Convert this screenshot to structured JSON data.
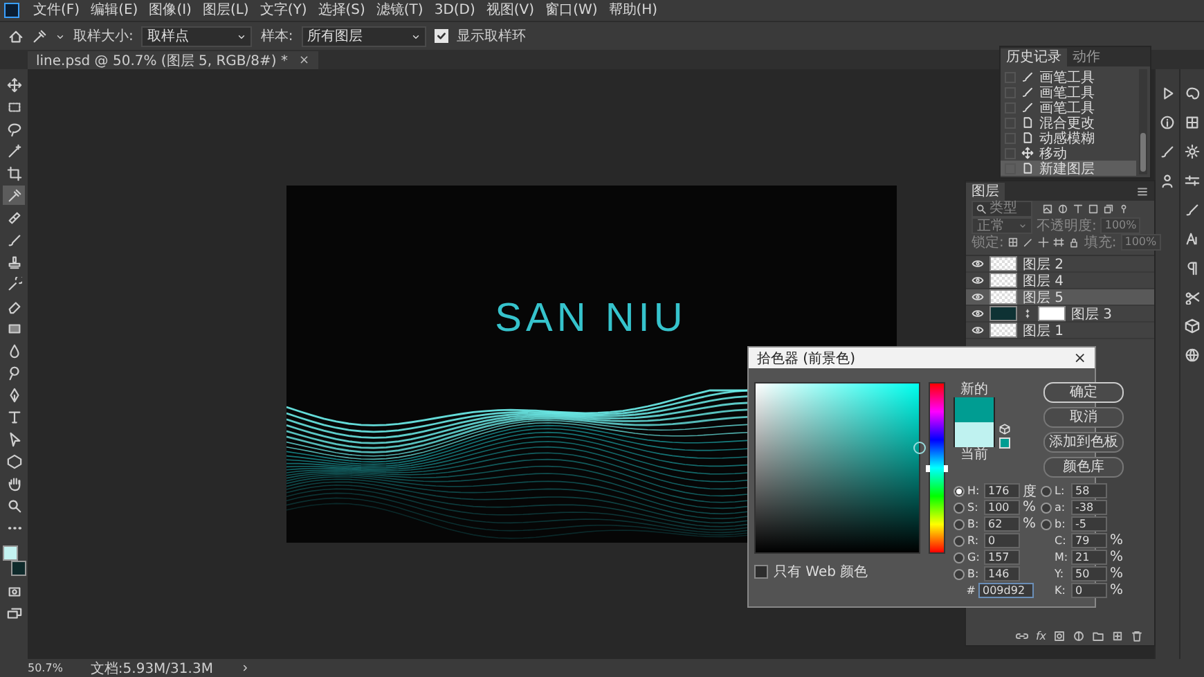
{
  "menu": [
    "文件(F)",
    "编辑(E)",
    "图像(I)",
    "图层(L)",
    "文字(Y)",
    "选择(S)",
    "滤镜(T)",
    "3D(D)",
    "视图(V)",
    "窗口(W)",
    "帮助(H)"
  ],
  "options_bar": {
    "sample_size_label": "取样大小:",
    "sample_size": "取样点",
    "sample_label": "样本:",
    "sample": "所有图层",
    "show_ring": {
      "label": "显示取样环",
      "checked": true
    }
  },
  "document_tab": {
    "title": "line.psd @ 50.7% (图层 5, RGB/8#) *",
    "close": "×"
  },
  "toolbar": {
    "tools": [
      {
        "kind": "move",
        "selected": false
      },
      {
        "kind": "marquee",
        "selected": false
      },
      {
        "kind": "lasso",
        "selected": false
      },
      {
        "kind": "wand",
        "selected": false
      },
      {
        "kind": "crop",
        "selected": false
      },
      {
        "kind": "eyedropper",
        "selected": true
      },
      {
        "kind": "heal",
        "selected": false
      },
      {
        "kind": "brush",
        "selected": false
      },
      {
        "kind": "stamp",
        "selected": false
      },
      {
        "kind": "history",
        "selected": false
      },
      {
        "kind": "eraser",
        "selected": false
      },
      {
        "kind": "gradient",
        "selected": false
      },
      {
        "kind": "drop",
        "selected": false
      },
      {
        "kind": "dodge",
        "selected": false
      },
      {
        "kind": "pen",
        "selected": false
      },
      {
        "kind": "type",
        "selected": false
      },
      {
        "kind": "select",
        "selected": false
      },
      {
        "kind": "shape",
        "selected": false
      },
      {
        "kind": "hand",
        "selected": false
      },
      {
        "kind": "zoom",
        "selected": false
      },
      {
        "kind": "more",
        "selected": false
      }
    ],
    "color_swatches": [
      {
        "color": "#c4f3f1"
      },
      {
        "color": "#0f2a2b"
      }
    ],
    "mode_tools": [
      {
        "kind": "quickmask"
      },
      {
        "kind": "screen"
      }
    ]
  },
  "canvas": {
    "headline": "SAN NIU"
  },
  "history_panel": {
    "tabs": [
      {
        "label": "历史记录",
        "selected": true
      },
      {
        "label": "动作",
        "selected": false
      }
    ],
    "items": [
      {
        "kind": "brush",
        "label": "画笔工具",
        "selected": false
      },
      {
        "kind": "brush",
        "label": "画笔工具",
        "selected": false
      },
      {
        "kind": "brush",
        "label": "画笔工具",
        "selected": false
      },
      {
        "kind": "document",
        "label": "混合更改",
        "selected": false
      },
      {
        "kind": "document",
        "label": "动感模糊",
        "selected": false
      },
      {
        "kind": "move",
        "label": "移动",
        "selected": false
      },
      {
        "kind": "document",
        "label": "新建图层",
        "selected": true
      }
    ]
  },
  "layers_panel": {
    "title": "图层",
    "filter_placeholder": "类型",
    "blend_mode": "正常",
    "opacity_label": "不透明度:",
    "opacity": "100%",
    "lock_label": "锁定:",
    "fill_label": "填充:",
    "fill": "100%",
    "fx_label": "fx",
    "layers": [
      {
        "name": "图层 2",
        "kind": "pixel",
        "visible": true,
        "selected": false
      },
      {
        "name": "图层 4",
        "kind": "pixel",
        "visible": true,
        "selected": false
      },
      {
        "name": "图层 5",
        "kind": "pixel",
        "visible": true,
        "selected": true
      },
      {
        "name": "图层 3",
        "kind": "masked",
        "visible": true,
        "selected": false
      },
      {
        "name": "图层 1",
        "kind": "pixel",
        "visible": true,
        "selected": false
      }
    ]
  },
  "color_picker": {
    "title": "拾色器 (前景色)",
    "close": "×",
    "swatches": [
      {
        "label": "新的",
        "color": "#009d92"
      },
      {
        "label": "当前",
        "color": "#bff2f0"
      }
    ],
    "buttons": [
      {
        "label": "确定",
        "default": true
      },
      {
        "label": "取消",
        "default": false
      },
      {
        "label": "添加到色板",
        "default": false
      },
      {
        "label": "颜色库",
        "default": false
      }
    ],
    "fields_left": [
      {
        "label": "H:",
        "value": "176",
        "unit": "度",
        "radio": true,
        "selected": true
      },
      {
        "label": "S:",
        "value": "100",
        "unit": "%",
        "radio": true,
        "selected": false
      },
      {
        "label": "B:",
        "value": "62",
        "unit": "%",
        "radio": true,
        "selected": false
      },
      {
        "label": "R:",
        "value": "0",
        "radio": true,
        "selected": false
      },
      {
        "label": "G:",
        "value": "157",
        "radio": true,
        "selected": false
      },
      {
        "label": "B:",
        "value": "146",
        "radio": true,
        "selected": false
      }
    ],
    "fields_right": [
      {
        "label": "L:",
        "value": "58",
        "radio": true,
        "selected": false
      },
      {
        "label": "a:",
        "value": "-38",
        "radio": true,
        "selected": false
      },
      {
        "label": "b:",
        "value": "-5",
        "radio": true,
        "selected": false
      },
      {
        "label": "C:",
        "value": "79",
        "unit": "%",
        "radio": false
      },
      {
        "label": "M:",
        "value": "21",
        "unit": "%",
        "radio": false
      },
      {
        "label": "Y:",
        "value": "50",
        "unit": "%",
        "radio": false
      },
      {
        "label": "K:",
        "value": "0",
        "unit": "%",
        "radio": false
      }
    ],
    "hue_slider": {
      "level": 0.49
    },
    "hex_label": "#",
    "hex": "009d92",
    "web_only": {
      "label": "只有 Web 颜色",
      "checked": false
    }
  },
  "status_bar": {
    "zoom": "50.7%",
    "document_size": "文档:5.93M/31.3M"
  }
}
